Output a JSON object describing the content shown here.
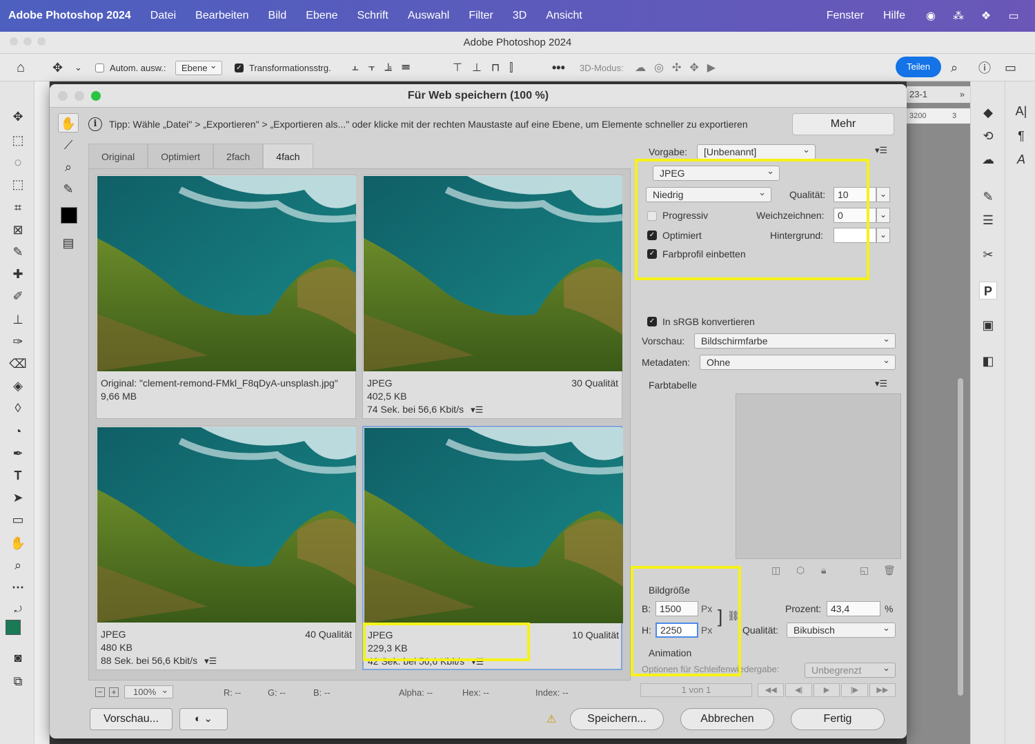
{
  "menubar": {
    "app": "Adobe Photoshop 2024",
    "items": [
      "Datei",
      "Bearbeiten",
      "Bild",
      "Ebene",
      "Schrift",
      "Auswahl",
      "Filter",
      "3D",
      "Ansicht"
    ],
    "right_items": [
      "Fenster",
      "Hilfe"
    ]
  },
  "ps": {
    "window_title": "Adobe Photoshop 2024",
    "options": {
      "auto_select_label": "Autom. ausw.:",
      "auto_select_value": "Ebene",
      "transform_label": "Transformationsstrg.",
      "mode3d_label": "3D-Modus:",
      "share_label": "Teilen"
    },
    "doc_tab": "23-1",
    "ruler_value": "3200",
    "ruler_value2": "3"
  },
  "dialog": {
    "title": "Für Web speichern (100 %)",
    "tip": "Tipp: Wähle „Datei\" > „Exportieren\" > „Exportieren als...\" oder klicke mit der rechten Maustaste auf eine Ebene, um Elemente schneller zu exportieren",
    "more_label": "Mehr",
    "tabs": [
      "Original",
      "Optimiert",
      "2fach",
      "4fach"
    ],
    "active_tab": 3,
    "previews": [
      {
        "line1": "Original: \"clement-remond-FMkl_F8qDyA-unsplash.jpg\"",
        "line2": "9,66 MB",
        "line3": "",
        "quality": ""
      },
      {
        "line1": "JPEG",
        "line2": "402,5 KB",
        "line3": "74 Sek. bei 56,6 Kbit/s",
        "quality": "30 Qualität"
      },
      {
        "line1": "JPEG",
        "line2": "480 KB",
        "line3": "88 Sek. bei 56,6 Kbit/s",
        "quality": "40 Qualität"
      },
      {
        "line1": "JPEG",
        "line2": "229,3 KB",
        "line3": "42 Sek. bei 56,6 Kbit/s",
        "quality": "10 Qualität"
      }
    ],
    "status": {
      "zoom": "100%",
      "r": "R: --",
      "g": "G: --",
      "b": "B: --",
      "alpha": "Alpha: --",
      "hex": "Hex: --",
      "index": "Index: --"
    },
    "buttons": {
      "preview": "Vorschau...",
      "save": "Speichern...",
      "cancel": "Abbrechen",
      "done": "Fertig"
    },
    "settings": {
      "preset_label": "Vorgabe:",
      "preset_value": "[Unbenannt]",
      "format": "JPEG",
      "quality_preset": "Niedrig",
      "quality_label": "Qualität:",
      "quality_value": "10",
      "progressive_label": "Progressiv",
      "progressive_checked": false,
      "blur_label": "Weichzeichnen:",
      "blur_value": "0",
      "optimized_label": "Optimiert",
      "optimized_checked": true,
      "matte_label": "Hintergrund:",
      "embed_profile_label": "Farbprofil einbetten",
      "embed_profile_checked": true,
      "srgb_label": "In sRGB konvertieren",
      "srgb_checked": true,
      "preview_label": "Vorschau:",
      "preview_value": "Bildschirmfarbe",
      "metadata_label": "Metadaten:",
      "metadata_value": "Ohne",
      "color_table_label": "Farbtabelle",
      "image_size_label": "Bildgröße",
      "width_label": "B:",
      "width_value": "1500",
      "height_label": "H:",
      "height_value": "2250",
      "unit": "Px",
      "percent_label": "Prozent:",
      "percent_value": "43,4",
      "percent_unit": "%",
      "resample_label": "Qualität:",
      "resample_value": "Bikubisch",
      "animation_label": "Animation",
      "loop_label": "Optionen für Schleifenwiedergabe:",
      "loop_value": "Unbegrenzt",
      "frame_counter": "1 von 1"
    },
    "colors": {
      "highlight": "#f5f218",
      "accent": "#1473e6"
    }
  }
}
